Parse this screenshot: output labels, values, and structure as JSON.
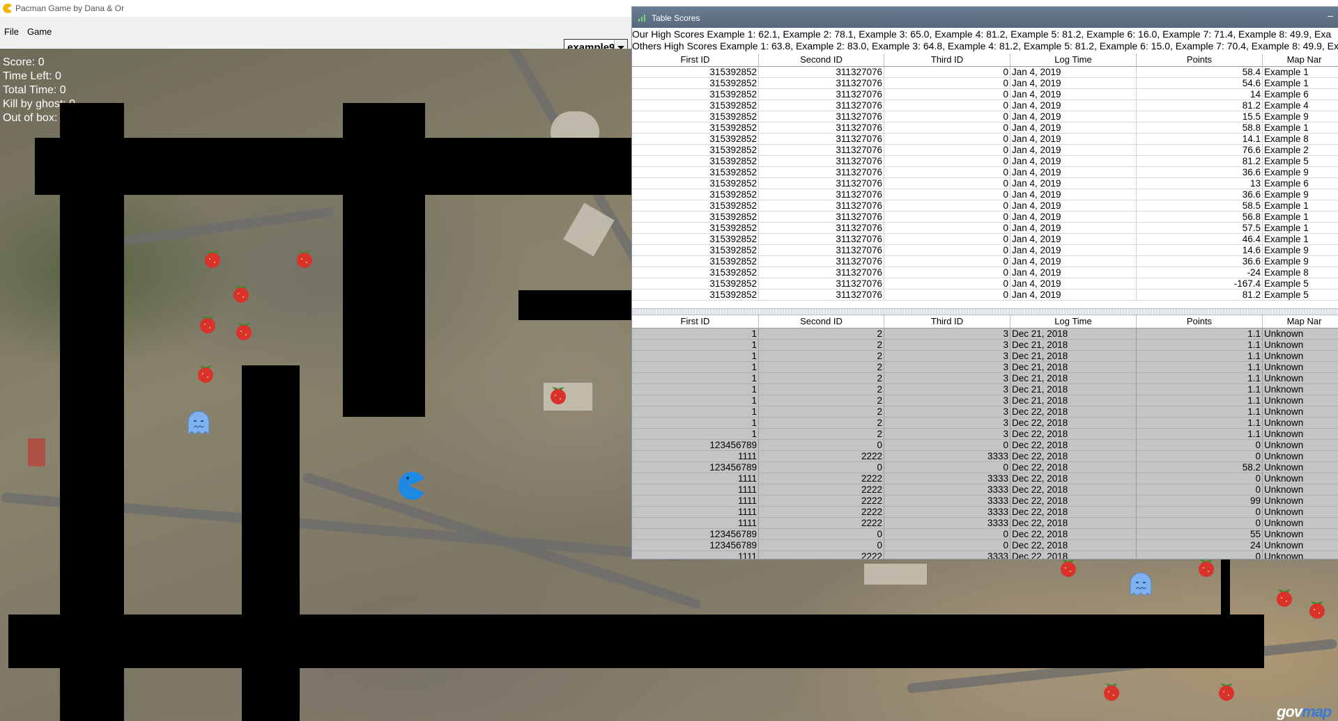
{
  "window": {
    "title": "Pacman Game by Dana & Or"
  },
  "menu": {
    "items": [
      {
        "label": "File"
      },
      {
        "label": "Game"
      }
    ]
  },
  "map_select": {
    "value": "example9"
  },
  "hud": {
    "score": "Score: 0",
    "time_left": "Time Left: 0",
    "total_time": "Total Time: 0",
    "kill_by_ghost": "Kill by ghost: 0",
    "out_of_box": "Out of box: 0"
  },
  "watermark": {
    "part1": "gov",
    "part2": "map"
  },
  "colors": {
    "wall": "#000000",
    "title_bar": "#5e7186",
    "others_rows": "#c4c4c4",
    "pacman": "#1e88e5",
    "ghost": "#7fb0f0",
    "fruit": "#d8322b"
  },
  "score_window": {
    "title": "Table Scores",
    "our_high_scores": "Our High Scores      Example 1: 62.1, Example 2: 78.1, Example 3: 65.0, Example 4: 81.2, Example 5: 81.2, Example 6: 16.0, Example 7: 71.4, Example 8: 49.9, Exa",
    "others_high_scores": "Others High Scores Example 1: 63.8, Example 2: 83.0, Example 3: 64.8, Example 4: 81.2, Example 5: 81.2, Example 6: 15.0, Example 7: 70.4, Example 8: 49.9, Exa",
    "columns": [
      "First ID",
      "Second ID",
      "Third ID",
      "Log Time",
      "Points",
      "Map Nar"
    ],
    "our_rows": [
      [
        "315392852",
        "311327076",
        "0",
        "Jan 4, 2019",
        "58.4",
        "Example 1"
      ],
      [
        "315392852",
        "311327076",
        "0",
        "Jan 4, 2019",
        "54.6",
        "Example 1"
      ],
      [
        "315392852",
        "311327076",
        "0",
        "Jan 4, 2019",
        "14",
        "Example 6"
      ],
      [
        "315392852",
        "311327076",
        "0",
        "Jan 4, 2019",
        "81.2",
        "Example 4"
      ],
      [
        "315392852",
        "311327076",
        "0",
        "Jan 4, 2019",
        "15.5",
        "Example 9"
      ],
      [
        "315392852",
        "311327076",
        "0",
        "Jan 4, 2019",
        "58.8",
        "Example 1"
      ],
      [
        "315392852",
        "311327076",
        "0",
        "Jan 4, 2019",
        "14.1",
        "Example 8"
      ],
      [
        "315392852",
        "311327076",
        "0",
        "Jan 4, 2019",
        "76.6",
        "Example 2"
      ],
      [
        "315392852",
        "311327076",
        "0",
        "Jan 4, 2019",
        "81.2",
        "Example 5"
      ],
      [
        "315392852",
        "311327076",
        "0",
        "Jan 4, 2019",
        "36.6",
        "Example 9"
      ],
      [
        "315392852",
        "311327076",
        "0",
        "Jan 4, 2019",
        "13",
        "Example 6"
      ],
      [
        "315392852",
        "311327076",
        "0",
        "Jan 4, 2019",
        "36.6",
        "Example 9"
      ],
      [
        "315392852",
        "311327076",
        "0",
        "Jan 4, 2019",
        "58.5",
        "Example 1"
      ],
      [
        "315392852",
        "311327076",
        "0",
        "Jan 4, 2019",
        "56.8",
        "Example 1"
      ],
      [
        "315392852",
        "311327076",
        "0",
        "Jan 4, 2019",
        "57.5",
        "Example 1"
      ],
      [
        "315392852",
        "311327076",
        "0",
        "Jan 4, 2019",
        "46.4",
        "Example 1"
      ],
      [
        "315392852",
        "311327076",
        "0",
        "Jan 4, 2019",
        "14.6",
        "Example 9"
      ],
      [
        "315392852",
        "311327076",
        "0",
        "Jan 4, 2019",
        "36.6",
        "Example 9"
      ],
      [
        "315392852",
        "311327076",
        "0",
        "Jan 4, 2019",
        "-24",
        "Example 8"
      ],
      [
        "315392852",
        "311327076",
        "0",
        "Jan 4, 2019",
        "-167.4",
        "Example 5"
      ],
      [
        "315392852",
        "311327076",
        "0",
        "Jan 4, 2019",
        "81.2",
        "Example 5"
      ]
    ],
    "others_rows": [
      [
        "1",
        "2",
        "3",
        "Dec 21, 2018",
        "1.1",
        "Unknown"
      ],
      [
        "1",
        "2",
        "3",
        "Dec 21, 2018",
        "1.1",
        "Unknown"
      ],
      [
        "1",
        "2",
        "3",
        "Dec 21, 2018",
        "1.1",
        "Unknown"
      ],
      [
        "1",
        "2",
        "3",
        "Dec 21, 2018",
        "1.1",
        "Unknown"
      ],
      [
        "1",
        "2",
        "3",
        "Dec 21, 2018",
        "1.1",
        "Unknown"
      ],
      [
        "1",
        "2",
        "3",
        "Dec 21, 2018",
        "1.1",
        "Unknown"
      ],
      [
        "1",
        "2",
        "3",
        "Dec 21, 2018",
        "1.1",
        "Unknown"
      ],
      [
        "1",
        "2",
        "3",
        "Dec 22, 2018",
        "1.1",
        "Unknown"
      ],
      [
        "1",
        "2",
        "3",
        "Dec 22, 2018",
        "1.1",
        "Unknown"
      ],
      [
        "1",
        "2",
        "3",
        "Dec 22, 2018",
        "1.1",
        "Unknown"
      ],
      [
        "123456789",
        "0",
        "0",
        "Dec 22, 2018",
        "0",
        "Unknown"
      ],
      [
        "1111",
        "2222",
        "3333",
        "Dec 22, 2018",
        "0",
        "Unknown"
      ],
      [
        "123456789",
        "0",
        "0",
        "Dec 22, 2018",
        "58.2",
        "Unknown"
      ],
      [
        "1111",
        "2222",
        "3333",
        "Dec 22, 2018",
        "0",
        "Unknown"
      ],
      [
        "1111",
        "2222",
        "3333",
        "Dec 22, 2018",
        "0",
        "Unknown"
      ],
      [
        "1111",
        "2222",
        "3333",
        "Dec 22, 2018",
        "99",
        "Unknown"
      ],
      [
        "1111",
        "2222",
        "3333",
        "Dec 22, 2018",
        "0",
        "Unknown"
      ],
      [
        "1111",
        "2222",
        "3333",
        "Dec 22, 2018",
        "0",
        "Unknown"
      ],
      [
        "123456789",
        "0",
        "0",
        "Dec 22, 2018",
        "55",
        "Unknown"
      ],
      [
        "123456789",
        "0",
        "0",
        "Dec 22, 2018",
        "24",
        "Unknown"
      ],
      [
        "1111",
        "2222",
        "3333",
        "Dec 22, 2018",
        "0",
        "Unknown"
      ]
    ]
  }
}
